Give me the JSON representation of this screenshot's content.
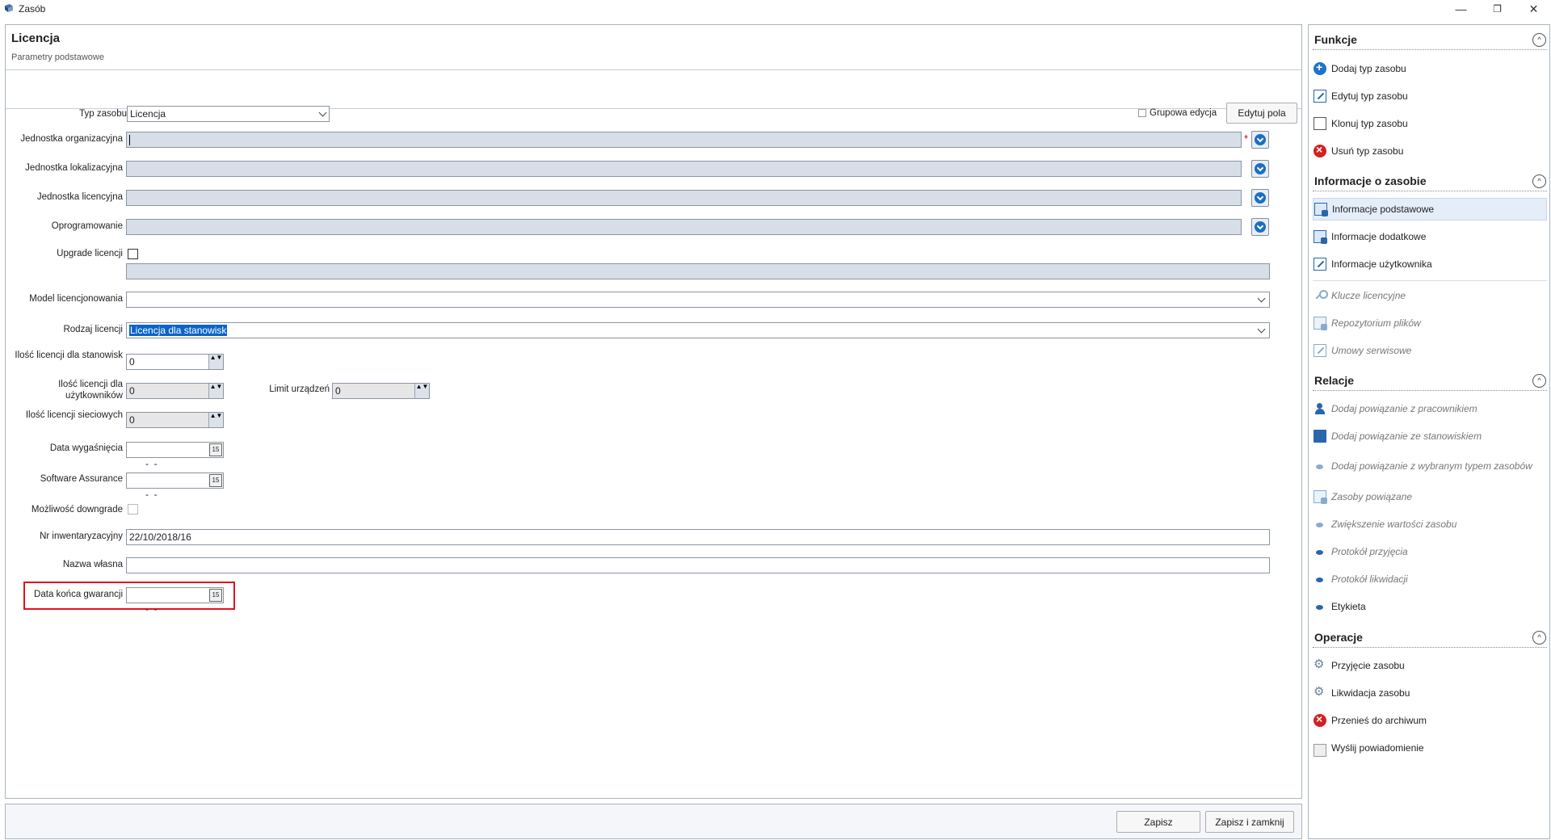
{
  "window": {
    "title": "Zasób",
    "minimize": "—",
    "restore": "❐",
    "close": "✕"
  },
  "header": {
    "title": "Licencja",
    "subtitle": "Parametry podstawowe"
  },
  "typebar": {
    "type_label": "Typ zasobu",
    "type_value": "Licencja",
    "group_edit_label": "Grupowa edycja",
    "edit_fields_button": "Edytuj pola"
  },
  "form": {
    "jedn_org_label": "Jednostka organizacyjna",
    "jedn_lok_label": "Jednostka lokalizacyjna",
    "jedn_lic_label": "Jednostka licencyjna",
    "oprogramowanie_label": "Oprogramowanie",
    "upgrade_label": "Upgrade licencji",
    "model_label": "Model licencjonowania",
    "model_value": "",
    "rodzaj_label": "Rodzaj licencji",
    "rodzaj_value": "Licencja dla stanowisk",
    "ilosc_stan_label": "Ilość licencji dla stanowisk",
    "ilosc_stan_value": "0",
    "ilosc_uzyt_label": "Ilość licencji dla użytkowników",
    "ilosc_uzyt_value": "0",
    "limit_label": "Limit urządzeń",
    "limit_value": "0",
    "ilosc_siec_label": "Ilość licencji sieciowych",
    "ilosc_siec_value": "0",
    "data_wyg_label": "Data wygaśnięcia",
    "data_wyg_value": "  -  -",
    "sa_label": "Software Assurance",
    "sa_value": "  -  -",
    "downgrade_label": "Możliwość downgrade",
    "nr_inw_label": "Nr inwentaryzacyjny",
    "nr_inw_value": "22/10/2018/16",
    "nazwa_label": "Nazwa własna",
    "nazwa_value": "",
    "gwarancja_label": "Data końca gwarancji",
    "gwarancja_value": "  -  -",
    "required_mark": "*"
  },
  "footer": {
    "save": "Zapisz",
    "save_close": "Zapisz i zamknij"
  },
  "sidebar": {
    "sections": {
      "funkcje": "Funkcje",
      "info": "Informacje o zasobie",
      "relacje": "Relacje",
      "operacje": "Operacje"
    },
    "collapse_glyph": "^",
    "funkcje": [
      "Dodaj typ zasobu",
      "Edytuj typ zasobu",
      "Klonuj typ zasobu",
      "Usuń typ zasobu"
    ],
    "info": [
      "Informacje podstawowe",
      "Informacje dodatkowe",
      "Informacje użytkownika",
      "Klucze licencyjne",
      "Repozytorium plików",
      "Umowy serwisowe"
    ],
    "relacje": [
      "Dodaj powiązanie z pracownikiem",
      "Dodaj powiązanie ze stanowiskiem",
      "Dodaj powiązanie z wybranym typem zasobów",
      "Zasoby powiązane",
      "Zwiększenie wartości zasobu",
      "Protokół przyjęcia",
      "Protokół likwidacji",
      "Etykieta"
    ],
    "operacje": [
      "Przyjęcie zasobu",
      "Likwidacja zasobu",
      "Przenieś do archiwum",
      "Wyślij powiadomienie"
    ]
  },
  "icons": {
    "calendar": "15",
    "spin": "▲▼"
  }
}
